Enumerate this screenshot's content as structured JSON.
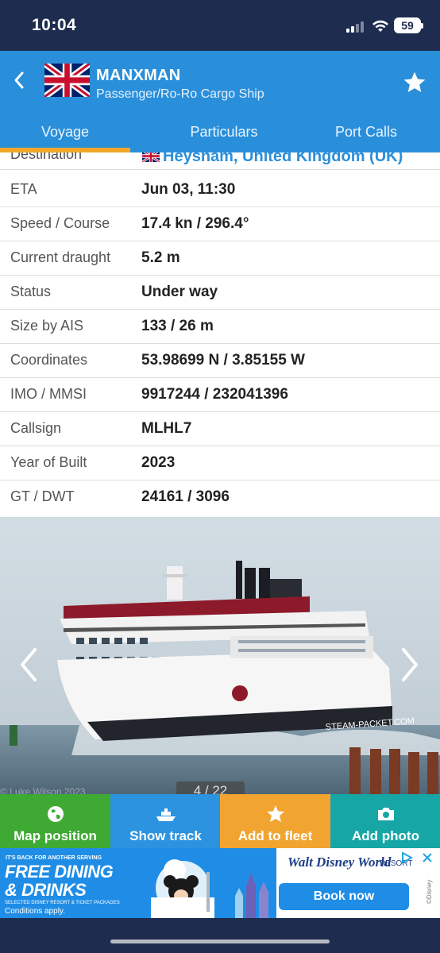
{
  "status_bar": {
    "time": "10:04",
    "battery": "59"
  },
  "header": {
    "ship_name": "MANXMAN",
    "ship_type": "Passenger/Ro-Ro Cargo Ship",
    "flag_icon": "uk-flag-icon",
    "back_icon": "chevron-left-icon",
    "favorite_icon": "star-icon"
  },
  "tabs": [
    {
      "label": "Voyage",
      "active": true
    },
    {
      "label": "Particulars",
      "active": false
    },
    {
      "label": "Port Calls",
      "active": false
    }
  ],
  "details": [
    {
      "label": "Destination",
      "value": "Heysham, United Kingdom (UK)"
    },
    {
      "label": "ETA",
      "value": "Jun 03, 11:30"
    },
    {
      "label": "Speed / Course",
      "value": "17.4 kn / 296.4°"
    },
    {
      "label": "Current draught",
      "value": "5.2 m"
    },
    {
      "label": "Status",
      "value": "Under way"
    },
    {
      "label": "Size by AIS",
      "value": "133 / 26 m"
    },
    {
      "label": "Coordinates",
      "value": "53.98699 N / 3.85155 W"
    },
    {
      "label": "IMO / MMSI",
      "value": "9917244 / 232041396"
    },
    {
      "label": "Callsign",
      "value": "MLHL7"
    },
    {
      "label": "Year of Built",
      "value": "2023"
    },
    {
      "label": "GT / DWT",
      "value": "24161 / 3096"
    }
  ],
  "photo": {
    "counter": "4 / 22",
    "credit": "© Luke Wilson 2023",
    "hull_text": "STEAM-PACKET.COM"
  },
  "actions": [
    {
      "label": "Map position",
      "icon": "globe-icon",
      "color": "#3eaa33"
    },
    {
      "label": "Show track",
      "icon": "ship-icon",
      "color": "#2c93e0"
    },
    {
      "label": "Add to fleet",
      "icon": "star-icon",
      "color": "#f2a431"
    },
    {
      "label": "Add photo",
      "icon": "camera-icon",
      "color": "#17a6a6"
    }
  ],
  "ad": {
    "small_text": "IT'S BACK FOR ANOTHER SERVING",
    "headline_1": "FREE DINING",
    "headline_2": "& DRINKS",
    "tiny_text": "SELECTED DISNEY RESORT & TICKET PACKAGES",
    "conditions": "Conditions apply.",
    "brand": "Walt Disney World",
    "brand_sub": "RESORT",
    "cta": "Book now",
    "disney_mark": "©Disney"
  },
  "colors": {
    "navy": "#1d2c4f",
    "header_blue": "#2a8fdb",
    "tab_indicator": "#f3a72a"
  }
}
